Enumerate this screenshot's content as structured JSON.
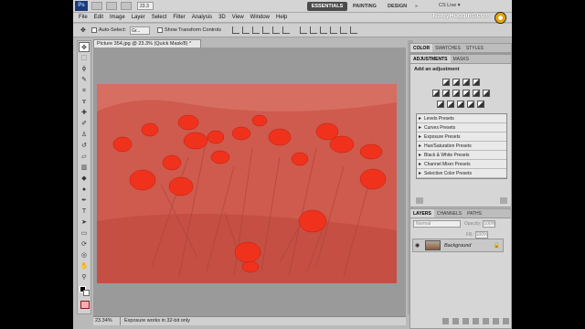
{
  "appbar": {
    "logo": "Ps",
    "zoom": "23.3",
    "workspaces": [
      "ESSENTIALS",
      "PAINTING",
      "DESIGN",
      "»"
    ],
    "cs_live": "CS Live ▾"
  },
  "menu": [
    "File",
    "Edit",
    "Image",
    "Layer",
    "Select",
    "Filter",
    "Analysis",
    "3D",
    "View",
    "Window",
    "Help"
  ],
  "brand": "BarryHuggins.com",
  "options": {
    "auto_select_label": "Auto-Select:",
    "auto_select_value": "Gr...",
    "show_transform_label": "Show Transform Controls"
  },
  "document": {
    "tab_title": "Picture 354.jpg @ 23.3% (Quick Mask/8) *",
    "zoom_status": "23.34%",
    "status_message": "Exposure works in 32-bit only"
  },
  "panels": {
    "color_tabs": [
      "COLOR",
      "SWATCHES",
      "STYLES"
    ],
    "adjust_tabs": [
      "ADJUSTMENTS",
      "MASKS"
    ],
    "adjust_title": "Add an adjustment",
    "presets": [
      "Levels Presets",
      "Curves Presets",
      "Exposure Presets",
      "Hue/Saturation Presets",
      "Black & White Presets",
      "Channel Mixer Presets",
      "Selective Color Presets"
    ],
    "layers_tabs": [
      "LAYERS",
      "CHANNELS",
      "PATHS"
    ],
    "blend_mode": "Normal",
    "opacity_label": "Opacity:",
    "opacity_value": "100%",
    "fill_label": "Fill:",
    "fill_value": "100%",
    "layer_name": "Background"
  },
  "colors": {
    "quick_mask_overlay": "#cf5a4e",
    "poppy": "#f0321c"
  }
}
